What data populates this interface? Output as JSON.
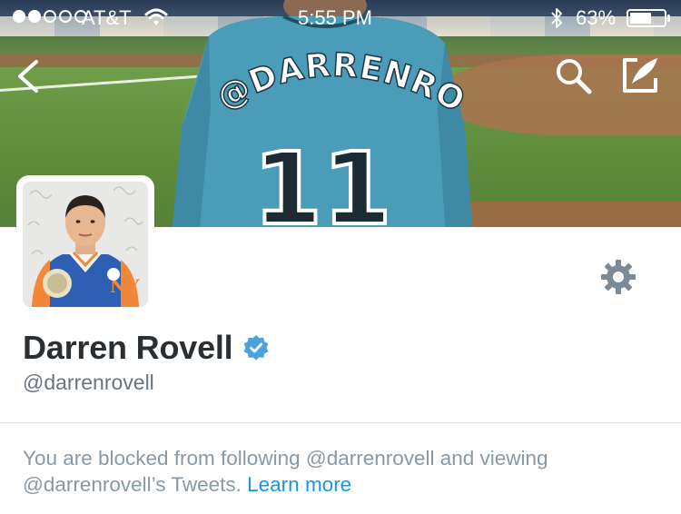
{
  "status_bar": {
    "carrier": "AT&T",
    "time": "5:55 PM",
    "battery_percent": "63%",
    "battery_level": 0.63,
    "signal_bars_filled": 2,
    "signal_bars_total": 5
  },
  "header": {
    "jersey_text": "@DARRENROVELL",
    "jersey_number": "11",
    "jersey_color": "#4a9cb8"
  },
  "profile": {
    "display_name": "Darren Rovell",
    "handle": "@darrenrovell",
    "verified": true
  },
  "blocked_notice": {
    "text": "You are blocked from following @darrenrovell and viewing @darrenrovell’s Tweets.",
    "link_label": "Learn more"
  },
  "colors": {
    "link": "#1b95e0",
    "verified_badge": "#4aa3df",
    "name": "#292f33",
    "secondary_text": "#66757f"
  },
  "icons": {
    "back": "chevron-left-icon",
    "search": "search-icon",
    "compose": "compose-icon",
    "settings": "gear-icon",
    "verified": "verified-badge-icon"
  }
}
